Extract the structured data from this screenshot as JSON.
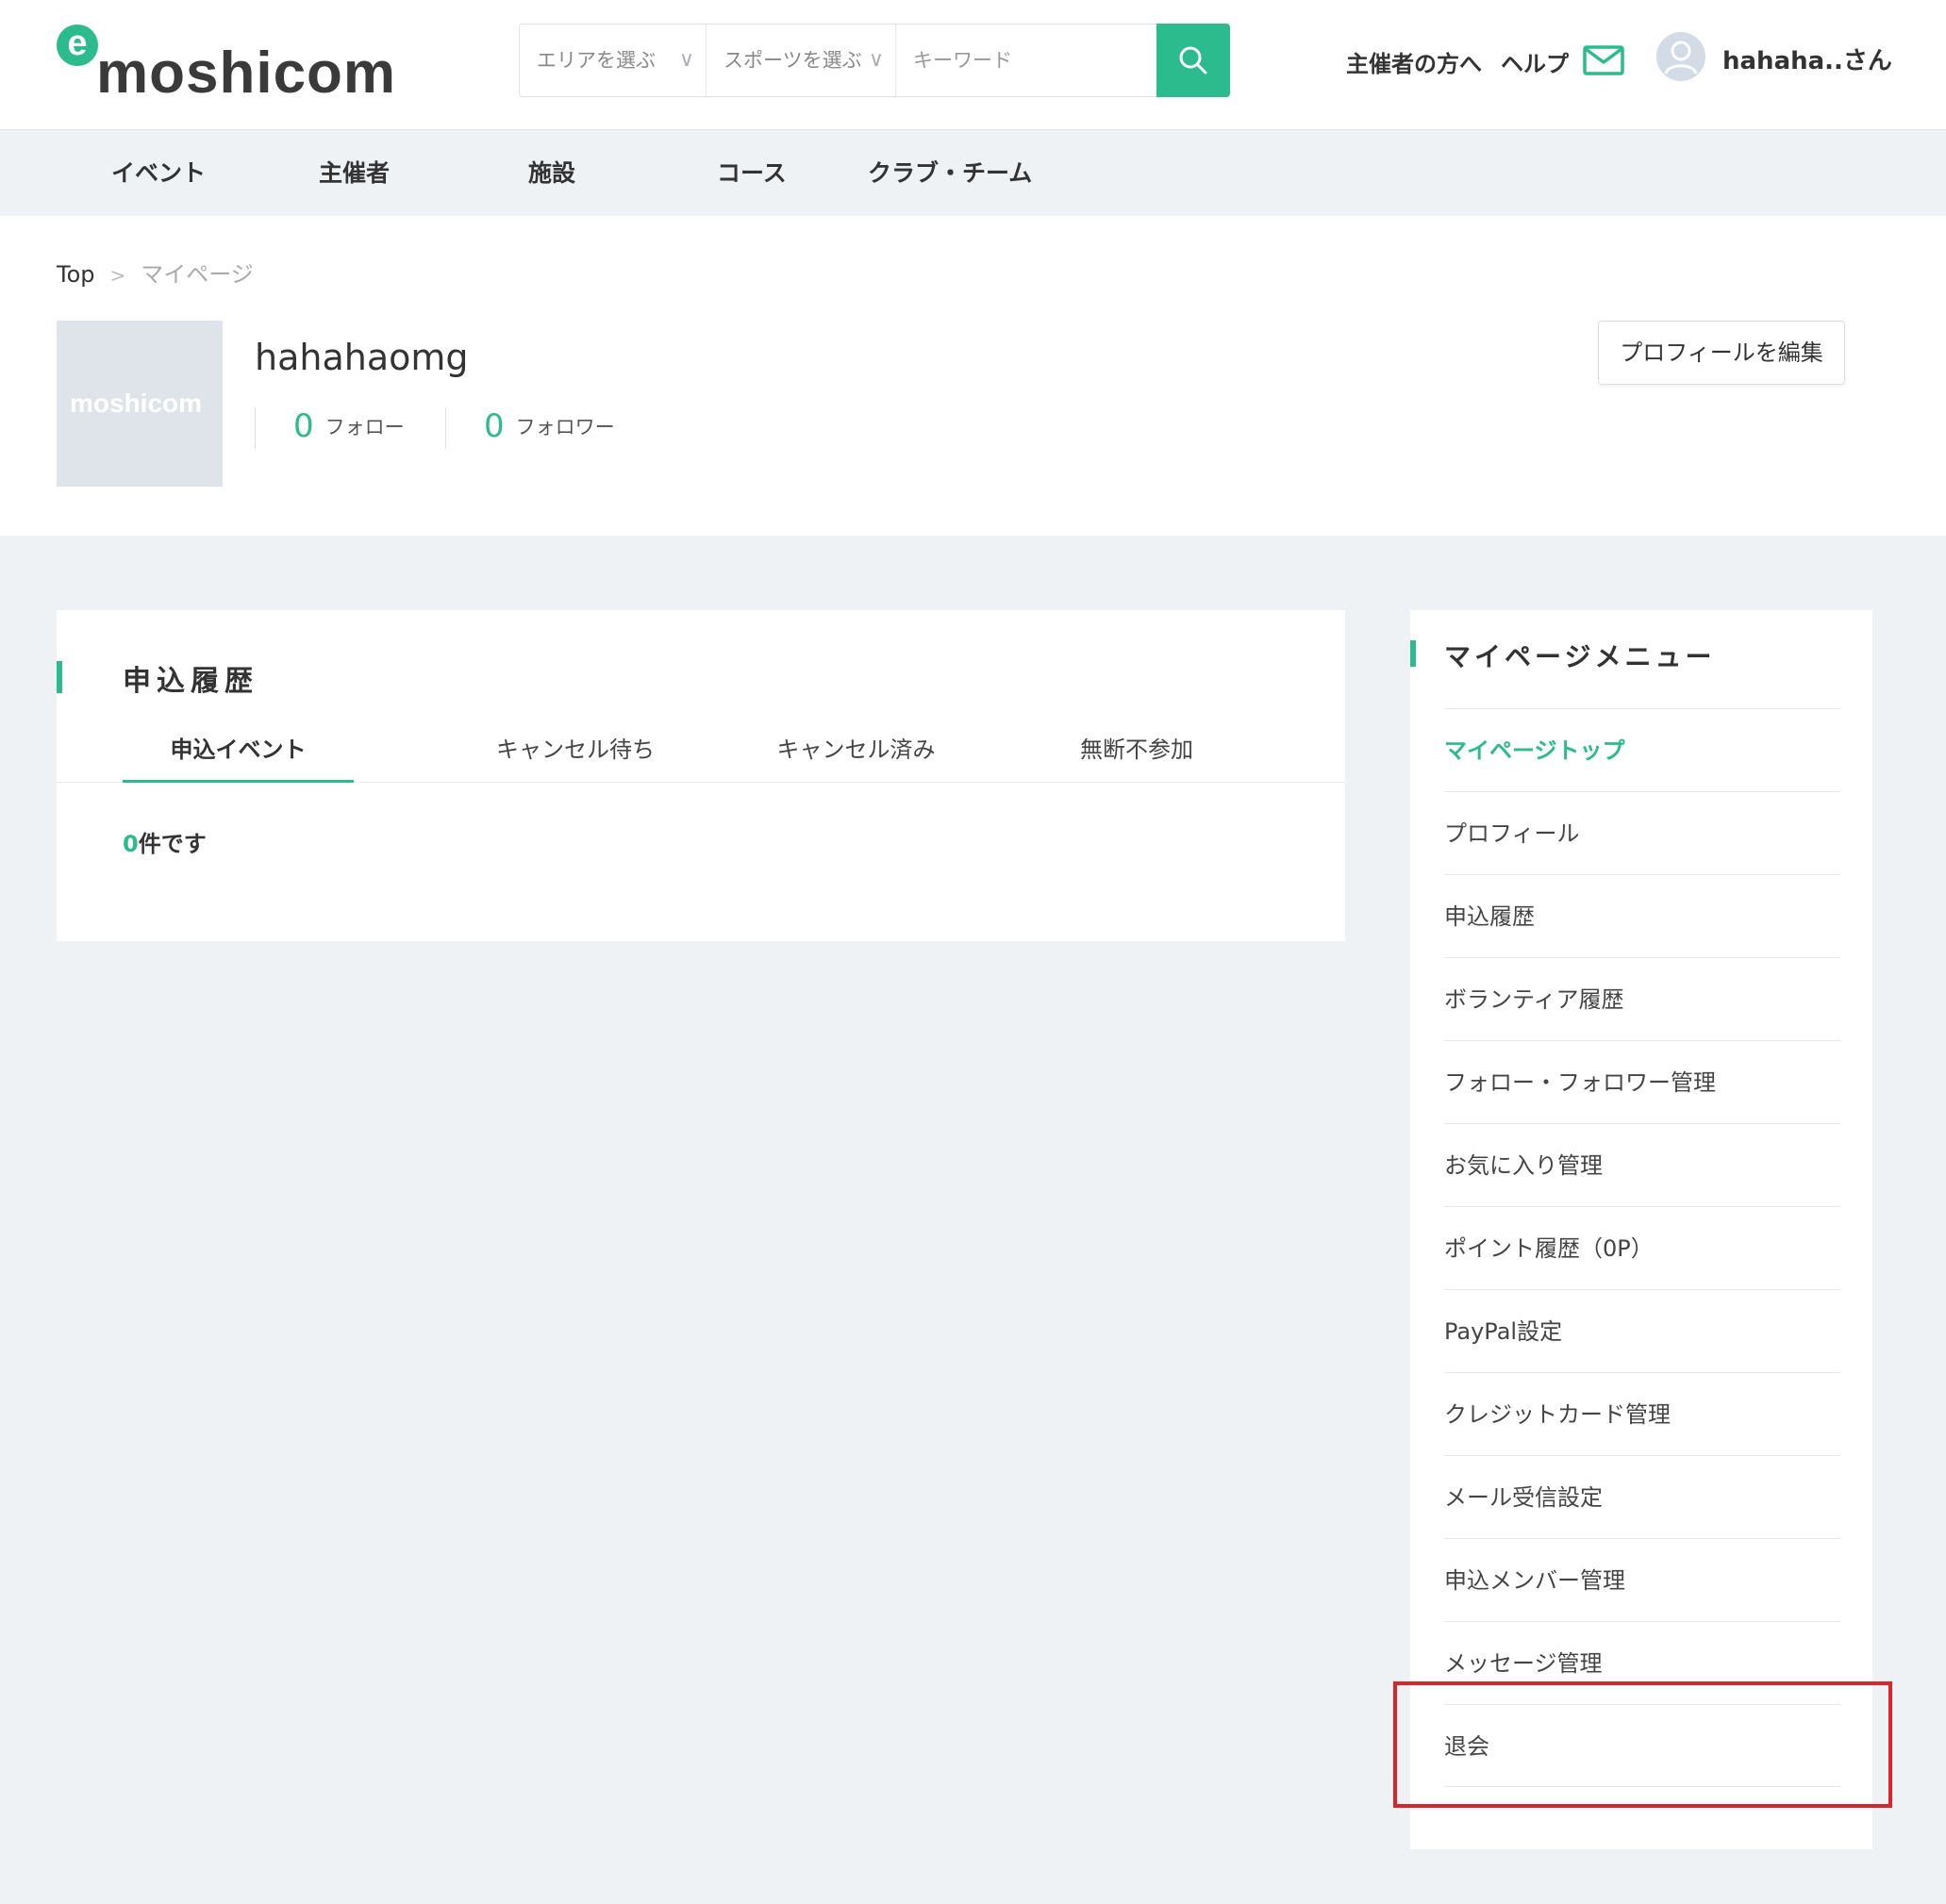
{
  "brand": {
    "logo_e": "e",
    "logo_text": "moshicom",
    "accent": "#2cbb8c"
  },
  "search": {
    "area_label": "エリアを選ぶ",
    "sport_label": "スポーツを選ぶ",
    "keyword_placeholder": "キーワード",
    "icon": "search-icon"
  },
  "header": {
    "organizer_link": "主催者の方へ",
    "help_link": "ヘルプ",
    "mail_icon": "mail-icon",
    "user_name": "hahaha..さん"
  },
  "nav": [
    "イベント",
    "主催者",
    "施設",
    "コース",
    "クラブ・チーム"
  ],
  "breadcrumb": {
    "top": "Top",
    "separator": ">",
    "current": "マイページ"
  },
  "profile": {
    "image_text": "moshicom",
    "name": "hahahaomg",
    "follow_count": "0",
    "follow_label": "フォロー",
    "follower_count": "0",
    "follower_label": "フォロワー",
    "edit_button": "プロフィールを編集"
  },
  "history": {
    "title": "申込履歴",
    "tabs": [
      "申込イベント",
      "キャンセル待ち",
      "キャンセル済み",
      "無断不参加"
    ],
    "active_tab": "申込イベント",
    "count_number": "0",
    "count_suffix": "件です"
  },
  "side_menu": {
    "title": "マイページメニュー",
    "items": [
      "マイページトップ",
      "プロフィール",
      "申込履歴",
      "ボランティア履歴",
      "フォロー・フォロワー管理",
      "お気に入り管理",
      "ポイント履歴（0P）",
      "PayPal設定",
      "クレジットカード管理",
      "メール受信設定",
      "申込メンバー管理",
      "メッセージ管理",
      "退会"
    ],
    "active_item": "マイページトップ",
    "highlighted_item": "退会",
    "highlight_color": "#d9262e"
  }
}
